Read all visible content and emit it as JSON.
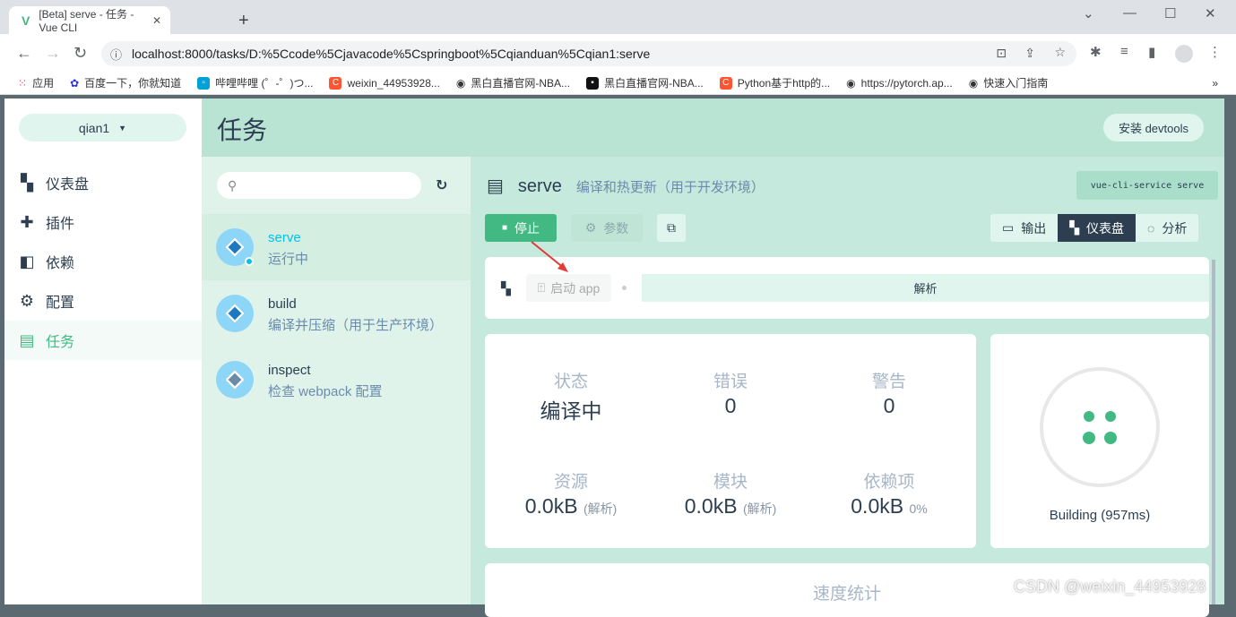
{
  "browser": {
    "tab_title": "[Beta] serve - 任务 - Vue CLI",
    "url": "localhost:8000/tasks/D:%5Ccode%5Cjavacode%5Cspringboot%5Cqianduan%5Cqian1:serve",
    "bookmarks": [
      {
        "label": "应用",
        "icon": "apps-grid-icon"
      },
      {
        "label": "百度一下，你就知道",
        "icon": "baidu-paw-icon"
      },
      {
        "label": "哔哩哔哩 (゜-゜)つ...",
        "icon": "bilibili-icon"
      },
      {
        "label": "weixin_44953928...",
        "icon": "csdn-c-icon"
      },
      {
        "label": "黑白直播官网-NBA...",
        "icon": "globe-icon"
      },
      {
        "label": "黑白直播官网-NBA...",
        "icon": "site-logo-icon"
      },
      {
        "label": "Python基于http的...",
        "icon": "csdn-c-icon"
      },
      {
        "label": "https://pytorch.ap...",
        "icon": "globe-icon"
      },
      {
        "label": "快速入门指南",
        "icon": "globe-icon"
      }
    ]
  },
  "sidebar": {
    "project": "qian1",
    "items": [
      {
        "label": "仪表盘",
        "icon": "dashboard-icon"
      },
      {
        "label": "插件",
        "icon": "puzzle-icon"
      },
      {
        "label": "依赖",
        "icon": "library-icon"
      },
      {
        "label": "配置",
        "icon": "gear-icon"
      },
      {
        "label": "任务",
        "icon": "clipboard-icon",
        "active": true
      }
    ]
  },
  "header": {
    "title": "任务",
    "devtools": "安装 devtools"
  },
  "tasks": [
    {
      "name": "serve",
      "desc": "运行中",
      "active": true
    },
    {
      "name": "build",
      "desc": "编译并压缩（用于生产环境）"
    },
    {
      "name": "inspect",
      "desc": "检查 webpack 配置"
    }
  ],
  "main": {
    "task": "serve",
    "task_desc": "编译和热更新（用于开发环境）",
    "command": "vue-cli-service serve",
    "stop": "停止",
    "params": "参数",
    "views": [
      "输出",
      "仪表盘",
      "分析"
    ],
    "selected_view": "仪表盘",
    "launch": "启动 app",
    "parse": "解析",
    "stats": {
      "status_label": "状态",
      "status": "编译中",
      "errors_label": "错误",
      "errors": "0",
      "warnings_label": "警告",
      "warnings": "0",
      "assets_label": "资源",
      "assets": "0.0kB",
      "assets_sub": "(解析)",
      "modules_label": "模块",
      "modules": "0.0kB",
      "modules_sub": "(解析)",
      "deps_label": "依赖项",
      "deps": "0.0kB",
      "deps_sub": "0%"
    },
    "progress": {
      "label": "Building (957ms)",
      "fraction": 0.1
    },
    "speed_title": "速度统计"
  },
  "watermark": "CSDN @weixin_44953928",
  "colors": {
    "accent": "#42b983",
    "dark": "#2c3e50",
    "running": "#03c2e6"
  }
}
